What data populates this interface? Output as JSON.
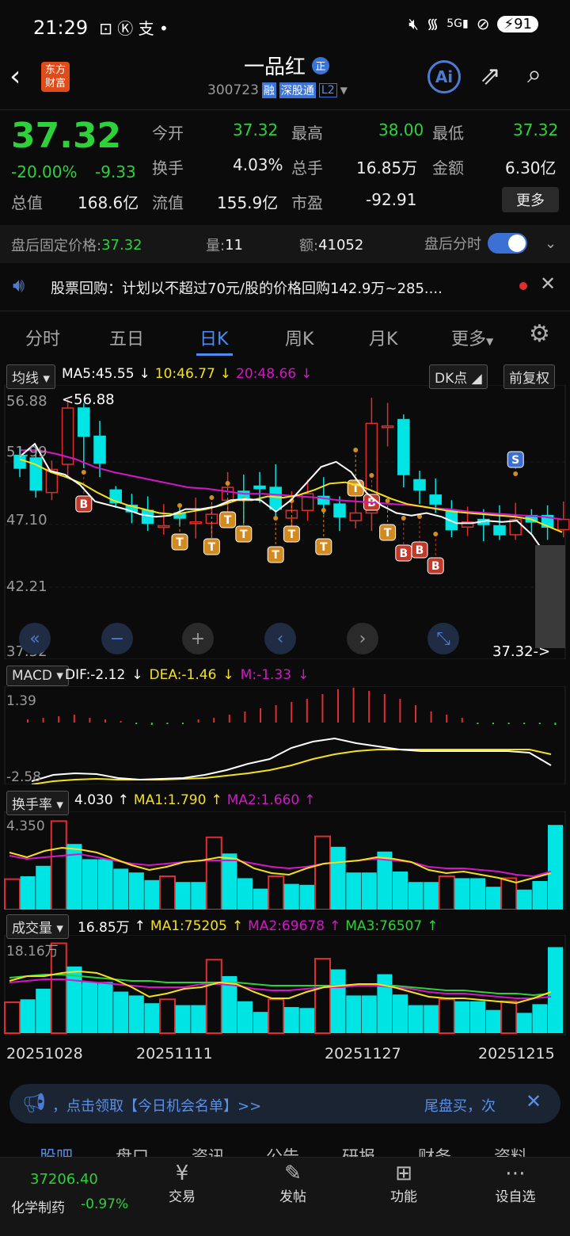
{
  "status_bar": {
    "time": "21:29",
    "apps": "⊡ Ⓚ 支 •",
    "battery": "91"
  },
  "header": {
    "logo_line1": "东方",
    "logo_line2": "财富",
    "title": "一品红",
    "title_badge": "正",
    "code": "300723",
    "tag_rong": "融",
    "tag_sgt": "深股通",
    "tag_l2": "L2"
  },
  "quote": {
    "price": "37.32",
    "pct": "-20.00%",
    "change": "-9.33",
    "fields": [
      {
        "label": "今开",
        "value": "37.32"
      },
      {
        "label": "最高",
        "value": "38.00"
      },
      {
        "label": "最低",
        "value": "37.32"
      },
      {
        "label": "换手",
        "value": "4.03%"
      },
      {
        "label": "总手",
        "value": "16.85万"
      },
      {
        "label": "金额",
        "value": "6.30亿"
      },
      {
        "label": "总值",
        "value": "168.6亿"
      },
      {
        "label": "流值",
        "value": "155.9亿"
      },
      {
        "label": "市盈",
        "value": "-92.91"
      }
    ],
    "more": "更多"
  },
  "after_hours": {
    "price_label": "盘后固定价格:",
    "price": "37.32",
    "vol_label": "量:",
    "vol": "11",
    "amt_label": "额:",
    "amt": "41052",
    "toggle_label": "盘后分时"
  },
  "notice": {
    "text": "股票回购：计划以不超过70元/股的价格回购142.9万~285...."
  },
  "tabs": [
    "分时",
    "五日",
    "日K",
    "周K",
    "月K",
    "更多"
  ],
  "active_tab": "日K",
  "kline": {
    "indicator": "均线",
    "ma5": "MA5:45.55",
    "ma10": "10:46.77",
    "ma20": "20:48.66",
    "dk": "DK点",
    "adjust": "前复权",
    "y_labels": [
      "56.88",
      "51.99",
      "47.10",
      "42.21",
      "37.32"
    ],
    "high_note": "<56.88",
    "low_note": "37.32->",
    "controls": [
      "«",
      "−",
      "+",
      "‹",
      "›",
      "⤡"
    ]
  },
  "macd": {
    "name": "MACD",
    "dif": "DIF:-2.12",
    "dea": "DEA:-1.46",
    "m": "M:-1.33",
    "top": "1.39",
    "bottom": "-2.58"
  },
  "turnover": {
    "name": "换手率",
    "value": "4.030",
    "ma1": "MA1:1.790",
    "ma2": "MA2:1.660",
    "top": "4.350"
  },
  "volume": {
    "name": "成交量",
    "value": "16.85万",
    "ma1": "MA1:75205",
    "ma2": "MA2:69678",
    "ma3": "MA3:76507",
    "top": "18.16万"
  },
  "dates": [
    "20251028",
    "20251111",
    "20251127",
    "20251215"
  ],
  "ad_bar": {
    "left": "，点击领取【今日机会名单】>>",
    "right": "尾盘买，次"
  },
  "sub_tabs": [
    "股吧",
    "盘口",
    "资讯",
    "公告",
    "研报",
    "财务",
    "资料"
  ],
  "bottom": {
    "index_value": "37206.40",
    "index_name": "化学制药",
    "index_pct": "-0.97%",
    "items": [
      "交易",
      "发帖",
      "功能",
      "设自选"
    ]
  },
  "colors": {
    "up": "#e02e2e",
    "down": "#00e4e4",
    "ma5": "#ffffff",
    "ma10": "#f5e11b",
    "ma20": "#d516c9",
    "green": "#2fd13a",
    "accent": "#4d7bd1"
  }
}
